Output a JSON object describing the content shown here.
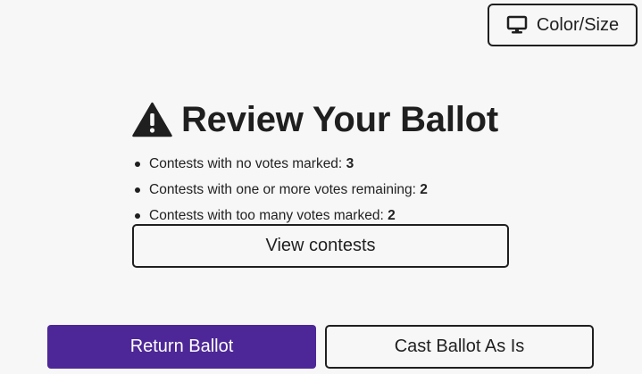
{
  "header": {
    "color_size_button": {
      "label": "Color/Size",
      "icon": "monitor-icon"
    }
  },
  "review": {
    "title": "Review Your Ballot",
    "icon": "warning-icon",
    "items": [
      {
        "label": "Contests with no votes marked:",
        "count": "3"
      },
      {
        "label": "Contests with one or more votes remaining:",
        "count": "2"
      },
      {
        "label": "Contests with too many votes marked:",
        "count": "2"
      }
    ],
    "view_contests_label": "View contests"
  },
  "footer": {
    "return_ballot_label": "Return Ballot",
    "cast_ballot_label": "Cast Ballot As Is"
  },
  "colors": {
    "primary": "#4d2797",
    "text": "#1f1f1f",
    "background": "#f7f7f7"
  }
}
